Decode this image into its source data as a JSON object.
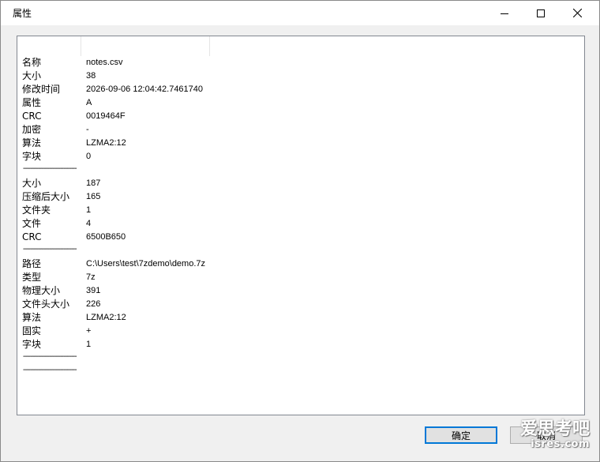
{
  "window": {
    "title": "属性"
  },
  "properties": [
    {
      "name": "名称",
      "value": "notes.csv"
    },
    {
      "name": "大小",
      "value": "38"
    },
    {
      "name": "修改时间",
      "value": "2026-09-06 12:04:42.7461740"
    },
    {
      "name": "属性",
      "value": "A"
    },
    {
      "name": "CRC",
      "value": "0019464F"
    },
    {
      "name": "加密",
      "value": "-"
    },
    {
      "name": "算法",
      "value": "LZMA2:12"
    },
    {
      "name": "字块",
      "value": "0"
    },
    {
      "separator": "-----------------------------"
    },
    {
      "name": "大小",
      "value": "187"
    },
    {
      "name": "压缩后大小",
      "value": "165"
    },
    {
      "name": "文件夹",
      "value": "1"
    },
    {
      "name": "文件",
      "value": "4"
    },
    {
      "name": "CRC",
      "value": "6500B650"
    },
    {
      "separator": "-----------------------------"
    },
    {
      "name": "路径",
      "value": "C:\\Users\\test\\7zdemo\\demo.7z"
    },
    {
      "name": "类型",
      "value": "7z"
    },
    {
      "name": "物理大小",
      "value": "391"
    },
    {
      "name": "文件头大小",
      "value": "226"
    },
    {
      "name": "算法",
      "value": "LZMA2:12"
    },
    {
      "name": "固实",
      "value": "+"
    },
    {
      "name": "字块",
      "value": "1"
    },
    {
      "separator": "-----------------------------"
    },
    {
      "separator": "-----------------------------"
    }
  ],
  "buttons": {
    "ok_label": "确定",
    "cancel_label": "取消"
  },
  "watermark": {
    "line1": "爱思考吧",
    "line2": "isres.com"
  }
}
